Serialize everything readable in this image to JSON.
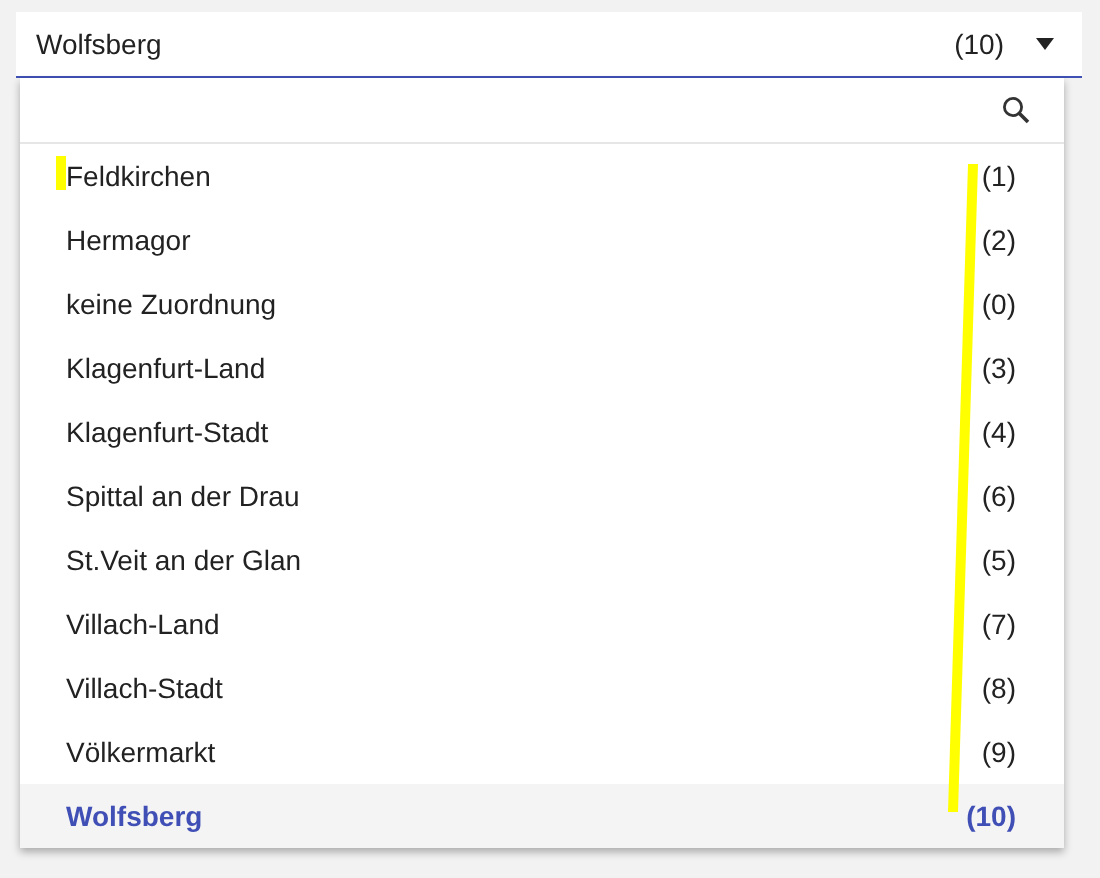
{
  "select": {
    "value": "Wolfsberg",
    "count": "(10)",
    "expanded": true
  },
  "options": [
    {
      "label": "Feldkirchen",
      "count": "(1)",
      "selected": false
    },
    {
      "label": "Hermagor",
      "count": "(2)",
      "selected": false
    },
    {
      "label": "keine Zuordnung",
      "count": "(0)",
      "selected": false
    },
    {
      "label": "Klagenfurt-Land",
      "count": "(3)",
      "selected": false
    },
    {
      "label": "Klagenfurt-Stadt",
      "count": "(4)",
      "selected": false
    },
    {
      "label": "Spittal an der Drau",
      "count": "(6)",
      "selected": false
    },
    {
      "label": "St.Veit an der Glan",
      "count": "(5)",
      "selected": false
    },
    {
      "label": "Villach-Land",
      "count": "(7)",
      "selected": false
    },
    {
      "label": "Villach-Stadt",
      "count": "(8)",
      "selected": false
    },
    {
      "label": "Völkermarkt",
      "count": "(9)",
      "selected": false
    },
    {
      "label": "Wolfsberg",
      "count": "(10)",
      "selected": true
    }
  ]
}
